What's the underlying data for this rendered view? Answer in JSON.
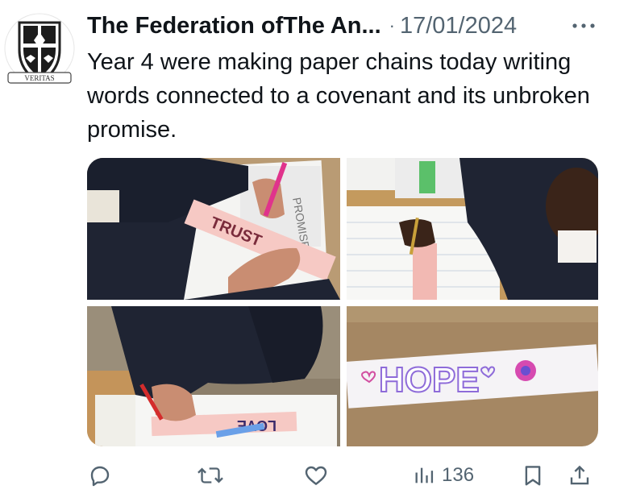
{
  "tweet": {
    "author": "The Federation ofThe An...",
    "separator": "·",
    "date": "17/01/2024",
    "text": "Year 4 were making paper chains today writing words connected to a covenant and its unbroken promise.",
    "avatar_motto": "VERITAS"
  },
  "media": {
    "photos": [
      {
        "strip_text": "TRUST",
        "sheet_text": "PROMISE"
      },
      {
        "strip_text": ""
      },
      {
        "strip_text": "LOVE"
      },
      {
        "strip_text": "HOPE"
      }
    ]
  },
  "actions": {
    "views_count": "136",
    "icons": [
      "reply-icon",
      "retweet-icon",
      "like-icon",
      "views-icon",
      "bookmark-icon",
      "share-icon"
    ]
  },
  "colors": {
    "text": "#0f1419",
    "muted": "#536471",
    "pink_strip": "#f6c9c4",
    "navy_uniform": "#1f2433"
  }
}
